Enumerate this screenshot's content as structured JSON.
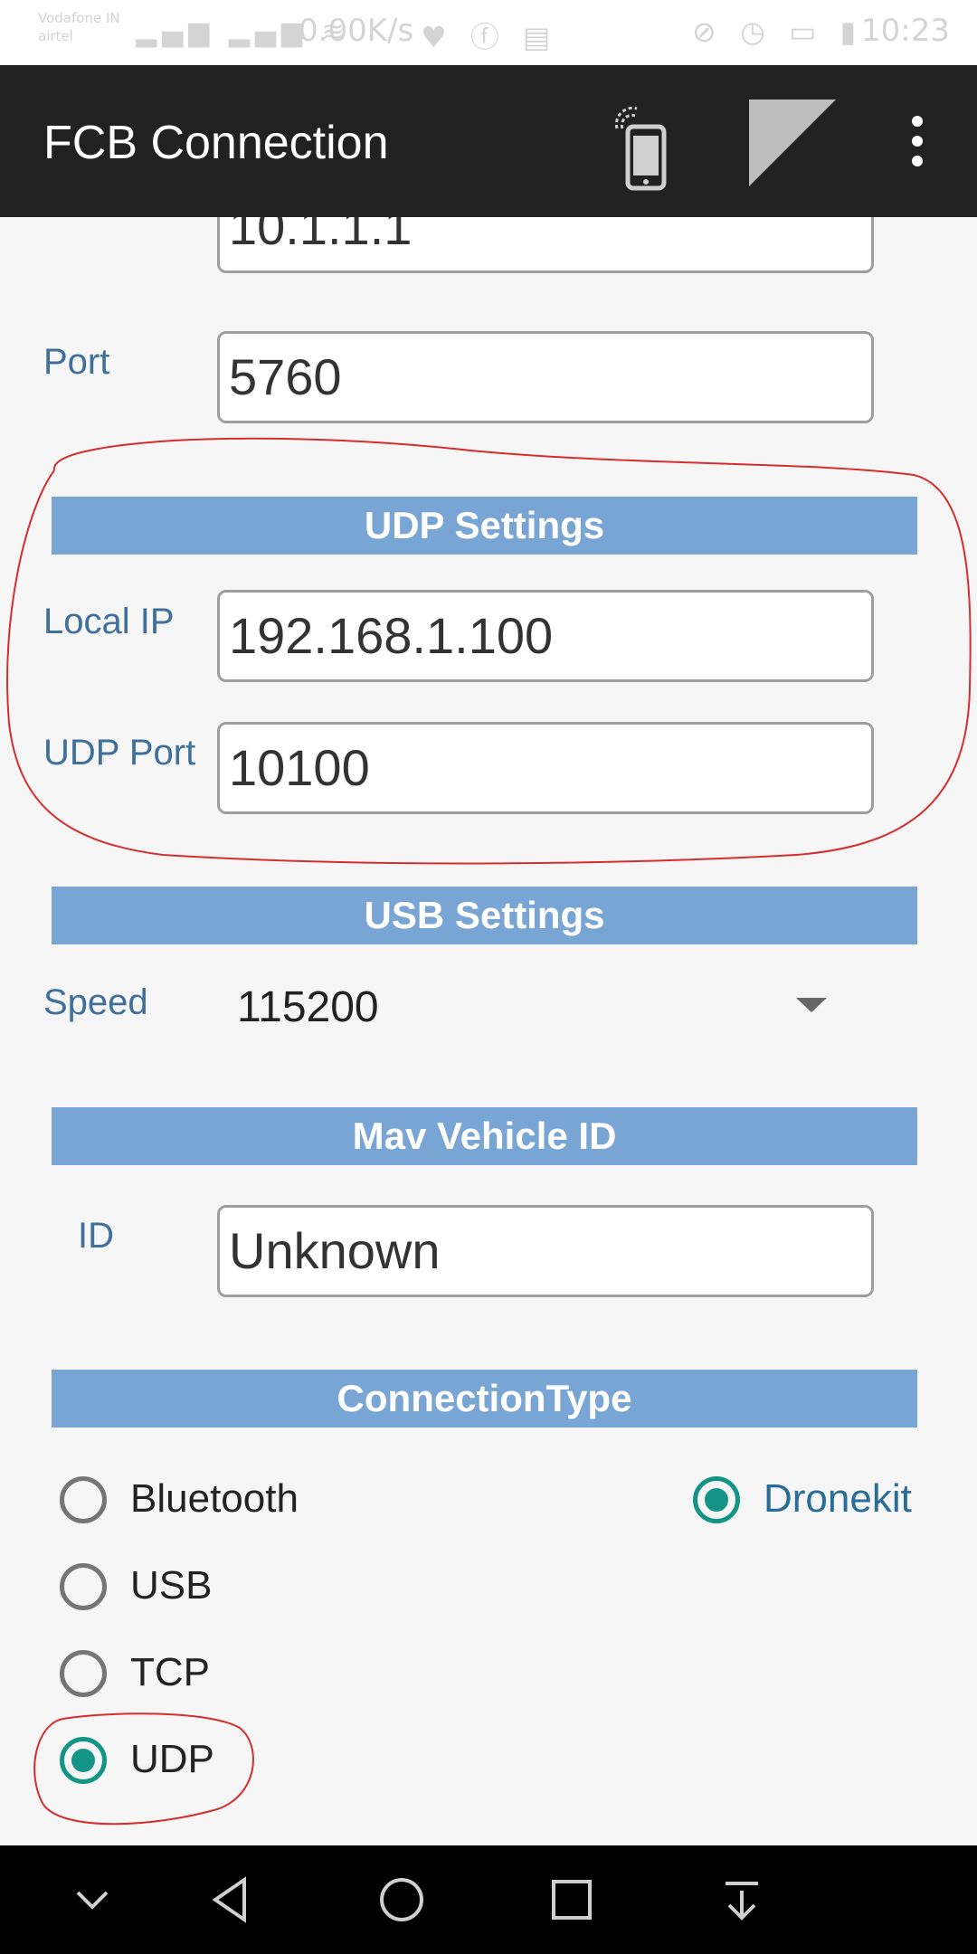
{
  "status_bar": {
    "carrier_line1": "Vodafone IN",
    "carrier_line2": "airtel",
    "net_speed": "0.00K/s",
    "time": "10:23"
  },
  "app_bar": {
    "title": "FCB Connection",
    "icons": [
      "phone-signal-icon",
      "corner-triangle-icon",
      "overflow-menu-icon"
    ]
  },
  "tcp": {
    "ip_partial_value": "10.1.1.1",
    "port_label": "Port",
    "port_value": "5760"
  },
  "udp_settings": {
    "header": "UDP Settings",
    "local_ip_label": "Local IP",
    "local_ip_value": "192.168.1.100",
    "udp_port_label": "UDP Port",
    "udp_port_value": "10100"
  },
  "usb_settings": {
    "header": "USB Settings",
    "speed_label": "Speed",
    "speed_value": "115200"
  },
  "mav_vehicle": {
    "header": "Mav Vehicle ID",
    "id_label": "ID",
    "id_value": "Unknown"
  },
  "connection_type": {
    "header": "ConnectionType",
    "options": [
      {
        "label": "Bluetooth",
        "checked": false
      },
      {
        "label": "USB",
        "checked": false
      },
      {
        "label": "TCP",
        "checked": false
      },
      {
        "label": "UDP",
        "checked": true
      }
    ],
    "dronekit": {
      "label": "Dronekit",
      "checked": true
    }
  },
  "colors": {
    "app_bar": "#212121",
    "section_header": "#78a5d3",
    "label_blue": "#3f6f9a",
    "radio_checked": "#139485",
    "annotation_red": "#d32f2f"
  }
}
